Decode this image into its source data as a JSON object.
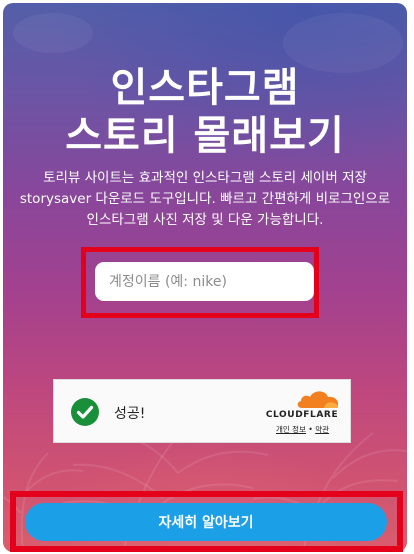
{
  "hero": {
    "title_line1": "인스타그램",
    "title_line2": "스토리 몰래보기",
    "description_lines": [
      "토리뷰 사이트는 효과적인 인스타그램 스토리 세이버 저장",
      "storysaver 다운로드 도구입니다. 빠르고 간편하게 비로그인으로",
      "인스타그램 사진 저장 및 다운 가능합니다."
    ]
  },
  "search": {
    "placeholder": "계정이름 (예: nike)",
    "value": ""
  },
  "captcha": {
    "status_text": "성공!",
    "brand": "CLOUDFLARE",
    "privacy_link": "개인 정보",
    "separator": "•",
    "terms_link": "약관",
    "success_color": "#1a8f3a",
    "brand_color": "#f38020"
  },
  "cta": {
    "label": "자세히 알아보기",
    "color": "#1ba0e8"
  },
  "highlight_color": "#e4001b"
}
